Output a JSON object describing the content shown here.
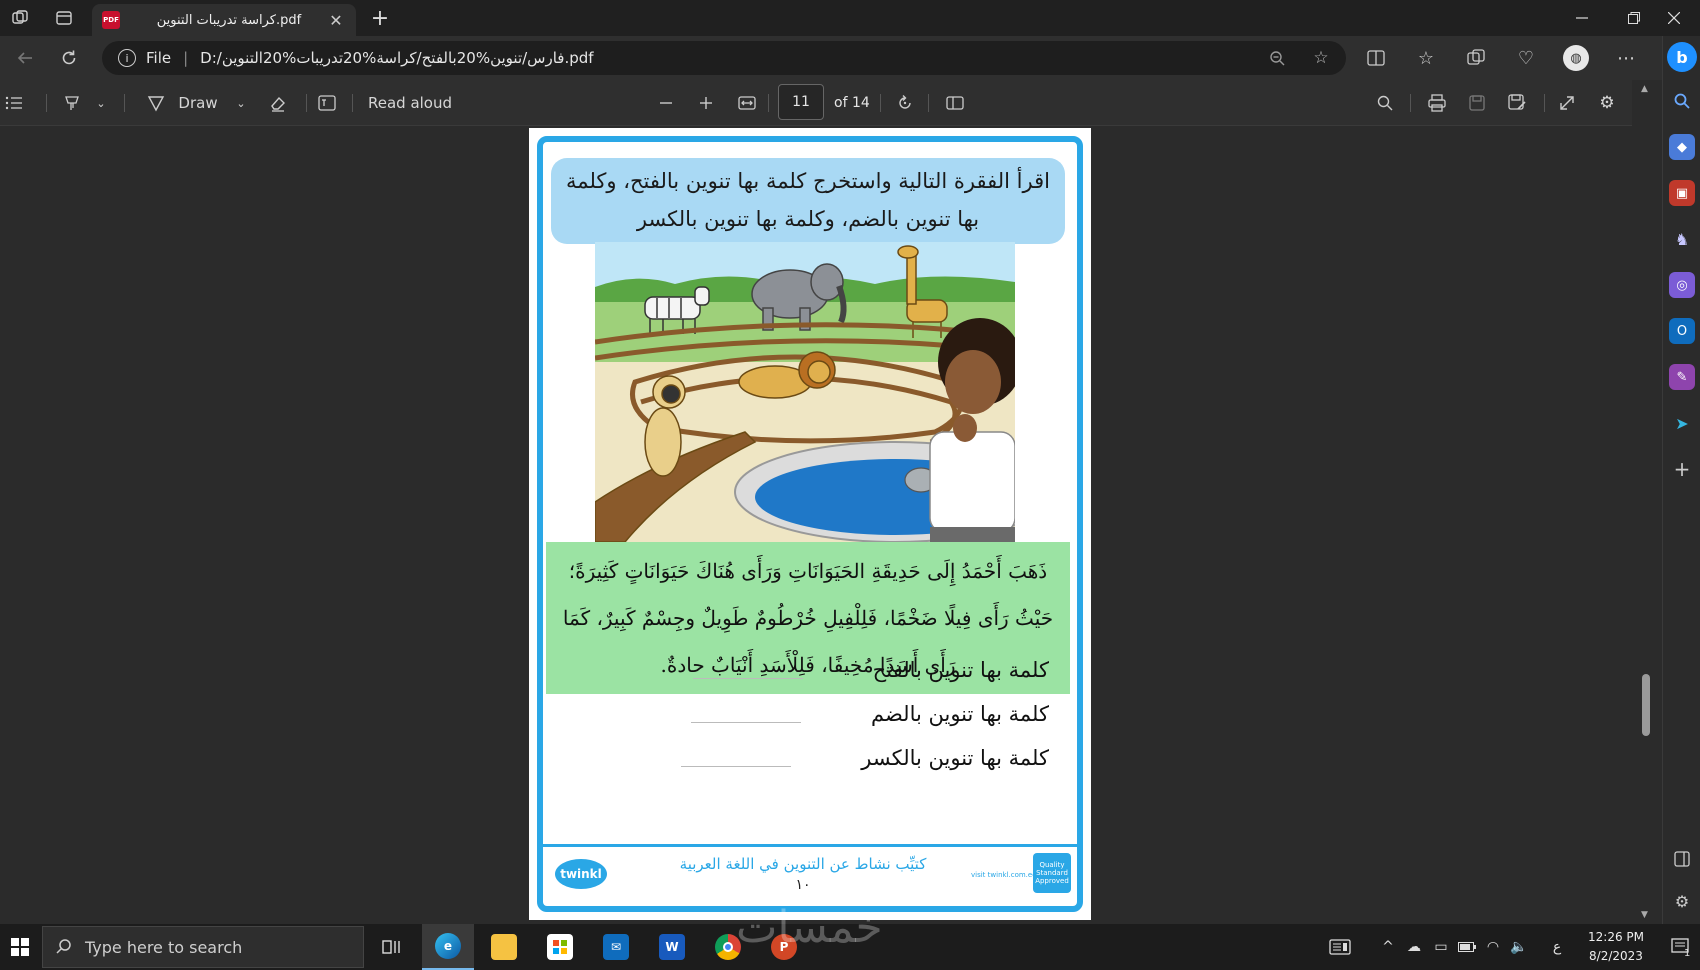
{
  "browser": {
    "tab_title": "كراسة تدريبات التنوين.pdf",
    "pdf_badge": "PDF",
    "close_glyph": "✕",
    "new_tab_glyph": "+",
    "address_scheme": "File",
    "address_url": "D:/فارس/تنوين%20بالفتح/كراسة%20تدريبات%20التنوين.pdf"
  },
  "pdf_toolbar": {
    "draw_label": "Draw",
    "read_aloud_label": "Read aloud",
    "current_page": "11",
    "page_of": "of 14"
  },
  "document": {
    "instruction": "اقرأ الفقرة التالية واستخرج كلمة بها تنوين بالفتح، وكلمة بها تنوين بالضم، وكلمة بها تنوين بالكسر",
    "story": "ذَهَبَ أَحْمَدُ إِلَى حَدِيقَةِ الحَيَوَانَاتِ وَرَأَى هُنَاكَ حَيَوَانَاتٍ كَثِيرَةً؛ حَيْثُ رَأَى فِيلًا ضَخْمًا، فَلِلْفِيلِ خُرْطُومٌ طَوِيلٌ وجِسْمٌ كَبِيرٌ، كَمَا رَأَى أَسَدًا مُخِيفًا، فَلِلْأَسَدِ أَنْيَابٌ حادةٌ.",
    "answers": [
      "كلمة بها تنوين بالفتح",
      "كلمة بها تنوين بالضم",
      "كلمة بها تنوين بالكسر"
    ],
    "footer_title": "كتيِّب نشاط عن التنوين في اللغة العربية",
    "footer_page": "١٠",
    "logo_text": "twinkl",
    "visit_text": "visit twinkl.com.eg",
    "badge_text": "Quality Standard Approved"
  },
  "taskbar": {
    "search_placeholder": "Type here to search",
    "time": "12:26 PM",
    "date": "8/2/2023",
    "lang": "ع",
    "notification_count": "1",
    "watermark": "خمسات"
  },
  "colors": {
    "frame_blue": "#2aa7e6",
    "instruction_bg": "#a9d9f4",
    "story_bg": "#9be3a3",
    "edge_accent": "#1e90ff"
  },
  "icons": {
    "sidebar": [
      "search-icon",
      "tag-icon",
      "briefcase-icon",
      "chess-icon",
      "copilot-icon",
      "outlook-icon",
      "notes-icon",
      "send-icon",
      "plus-icon",
      "split-icon",
      "settings-icon"
    ]
  }
}
